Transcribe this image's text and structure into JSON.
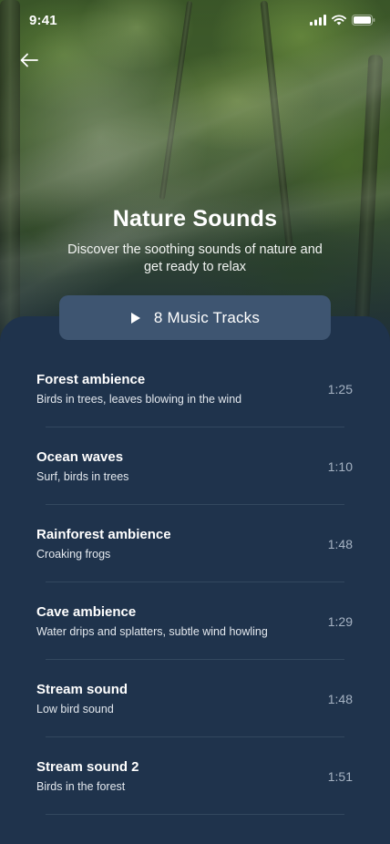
{
  "status_bar": {
    "time": "9:41"
  },
  "header": {
    "back_icon": "arrow-left-icon",
    "title": "Nature Sounds",
    "subtitle": "Discover the soothing sounds of nature and get ready to relax"
  },
  "tracks_button": {
    "icon": "play-icon",
    "label": "8 Music Tracks"
  },
  "tracks": [
    {
      "title": "Forest ambience",
      "description": "Birds in trees, leaves blowing in the wind",
      "duration": "1:25"
    },
    {
      "title": "Ocean waves",
      "description": "Surf, birds in trees",
      "duration": "1:10"
    },
    {
      "title": "Rainforest ambience",
      "description": "Croaking frogs",
      "duration": "1:48"
    },
    {
      "title": "Cave ambience",
      "description": "Water drips and splatters, subtle wind howling",
      "duration": "1:29"
    },
    {
      "title": "Stream sound",
      "description": "Low bird sound",
      "duration": "1:48"
    },
    {
      "title": "Stream sound 2",
      "description": "Birds in the forest",
      "duration": "1:51"
    }
  ],
  "colors": {
    "panel_background": "#1f334c",
    "pill_background": "#3e5571",
    "duration_text": "#a6b3c3",
    "divider": "#33485f"
  }
}
